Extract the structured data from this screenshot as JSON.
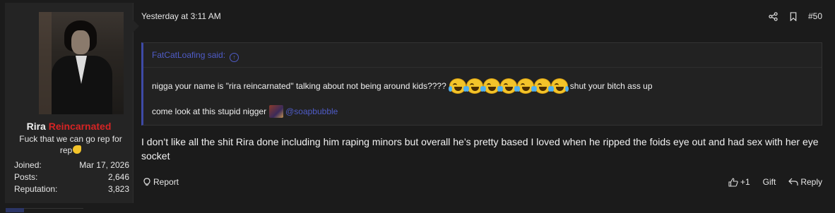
{
  "user": {
    "name_part1": "Rira ",
    "name_part2": "Reincarnated",
    "name_color": "#d62424",
    "title": "Fuck that we can go rep for rep",
    "title_emoji": "flexed-biceps-emoji",
    "stats": [
      {
        "label": "Joined:",
        "value": "Mar 17, 2026"
      },
      {
        "label": "Posts:",
        "value": "2,646"
      },
      {
        "label": "Reputation:",
        "value": "3,823"
      }
    ]
  },
  "post": {
    "date": "Yesterday at 3:11 AM",
    "number": "#50",
    "icons": [
      "share-icon",
      "bookmark-icon"
    ]
  },
  "quote": {
    "author": "FatCatLoafing said:",
    "line1_before": "nigga your name is \"rira reincarnated\" talking about not being around kids????",
    "line1_emoji_count": 7,
    "line1_after": "shut your bitch ass up",
    "line2_before": "come look at this stupid nigger",
    "mention": "@soapbubble",
    "accent_color": "#4f5cc8"
  },
  "body": {
    "text": "I don’t like all the shit Rira done including him raping minors but overall he’s pretty based I loved when he ripped the foids eye out and had sex with her eye socket"
  },
  "actions": {
    "report": "Report",
    "like_count": "+1",
    "gift": "Gift",
    "reply": "Reply"
  }
}
